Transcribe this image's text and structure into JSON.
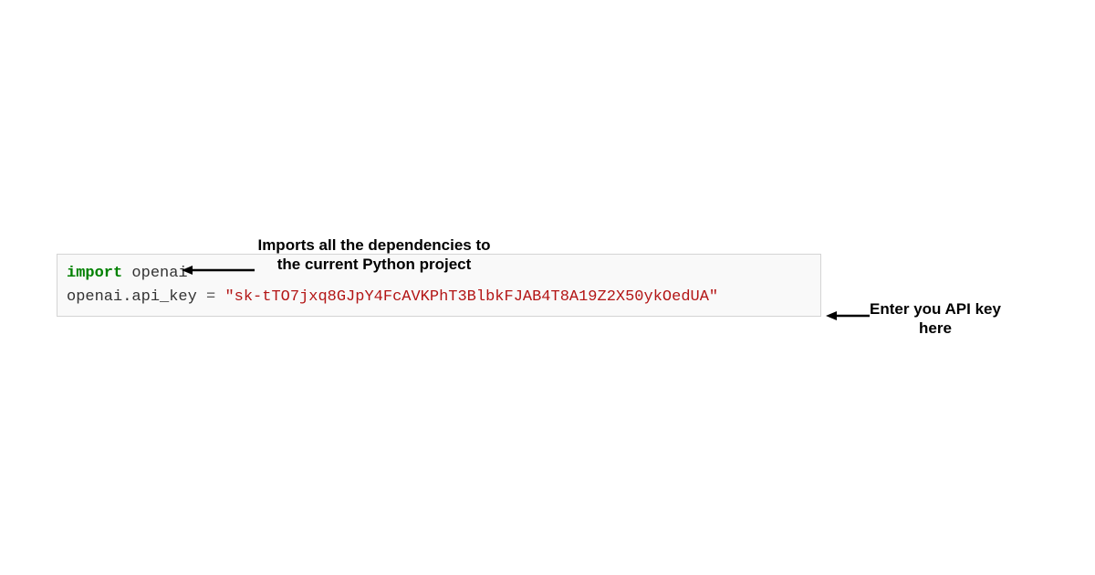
{
  "code": {
    "line1": {
      "keyword": "import",
      "module": " openai"
    },
    "blank": "",
    "line2": {
      "prefix": "openai.api_key ",
      "op": "=",
      "space": " ",
      "string": "\"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\""
    }
  },
  "annotations": {
    "import_note": "Imports all the dependencies to the current Python project",
    "api_note": "Enter you API key here"
  }
}
